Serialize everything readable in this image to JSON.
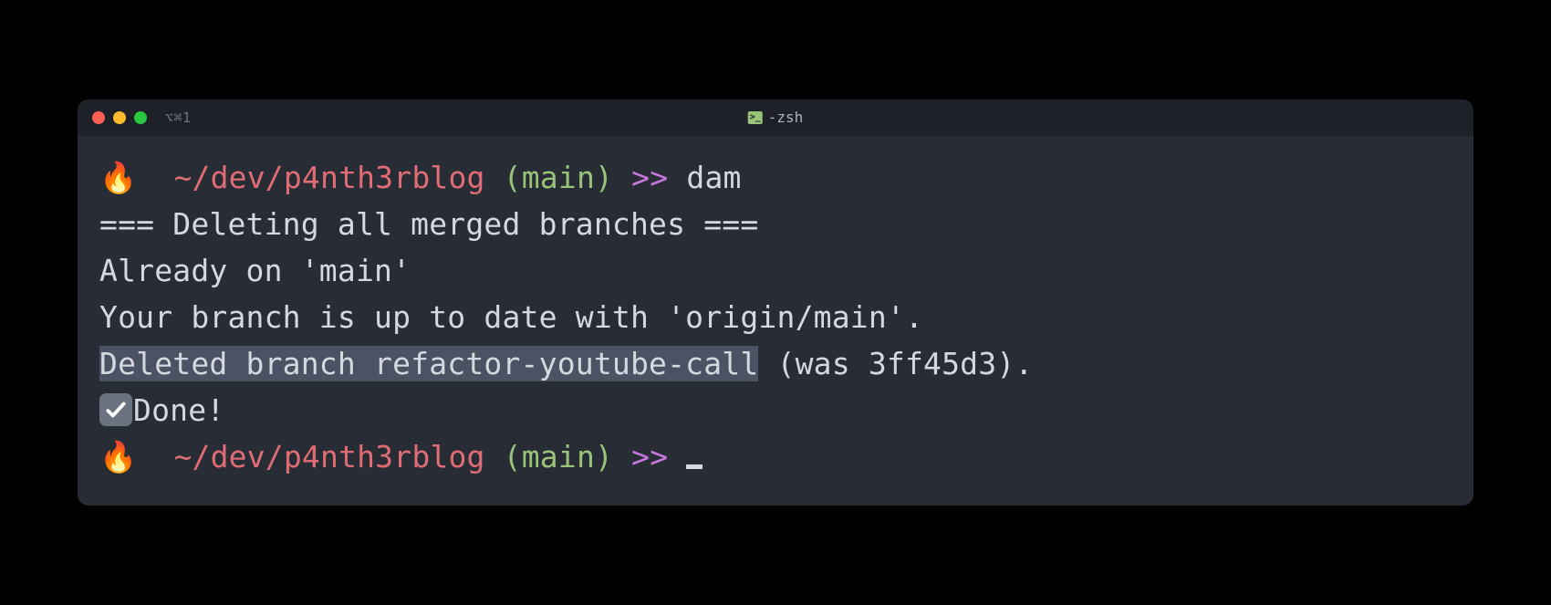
{
  "titlebar": {
    "tab_label": "⌥⌘1",
    "window_title": "-zsh"
  },
  "prompt1": {
    "fire": "🔥",
    "path": "~/dev/p4nth3rblog",
    "branch": "(main)",
    "arrows": ">>",
    "command": "dam"
  },
  "output": {
    "line1": "=== Deleting all merged branches ===",
    "line2": "Already on 'main'",
    "line3": "Your branch is up to date with 'origin/main'.",
    "line4_highlighted": "Deleted branch refactor-youtube-call",
    "line4_rest": " (was 3ff45d3).",
    "line5": "Done!"
  },
  "prompt2": {
    "fire": "🔥",
    "path": "~/dev/p4nth3rblog",
    "branch": "(main)",
    "arrows": ">>"
  }
}
